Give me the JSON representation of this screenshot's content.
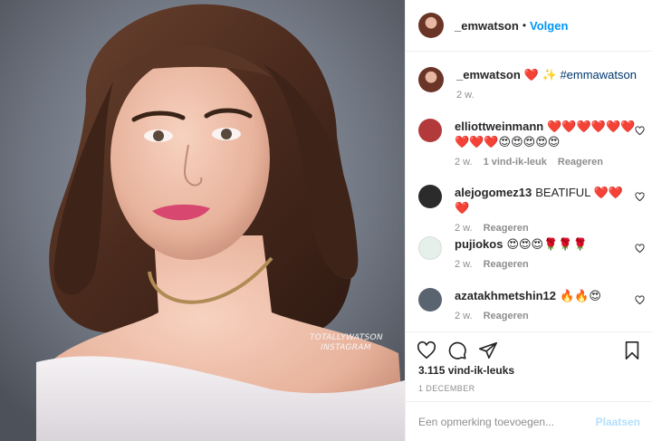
{
  "photo": {
    "watermark_line1": "TOTALLYWATSON",
    "watermark_line2": "INSTAGRAM"
  },
  "header": {
    "username": "_emwatson",
    "dot": "•",
    "follow_label": "Volgen"
  },
  "caption": {
    "username": "_emwatson",
    "text": "❤️ ✨",
    "hashtag": "#emmawatson",
    "time": "2 w."
  },
  "comments": [
    {
      "username": "elliottweinmann",
      "text": "❤️❤️❤️❤️❤️❤️❤️❤️❤️😍😍😍😍😍",
      "time": "2 w.",
      "likes": "1 vind-ik-leuk",
      "reply": "Reageren",
      "avatar_color": "#b23a3a"
    },
    {
      "username": "alejogomez13",
      "text": "BEATIFUL ❤️❤️❤️",
      "time": "2 w.",
      "likes": "",
      "reply": "Reageren",
      "avatar_color": "#2b2b2b"
    },
    {
      "username": "pujiokos",
      "text": "😍😍😍🌹🌹🌹",
      "time": "2 w.",
      "likes": "",
      "reply": "Reageren",
      "avatar_color": "#e6f0ea"
    },
    {
      "username": "azatakhmetshin12",
      "text": "🔥🔥😍",
      "time": "2 w.",
      "likes": "",
      "reply": "Reageren",
      "avatar_color": "#5a6470"
    }
  ],
  "icons": [
    "heart-icon",
    "comment-icon",
    "share-icon",
    "bookmark-icon"
  ],
  "likes_count": "3.115 vind-ik-leuks",
  "post_date": "1 DECEMBER",
  "composer": {
    "placeholder": "Een opmerking toevoegen...",
    "post_label": "Plaatsen"
  },
  "colors": {
    "accent": "#0095f6",
    "post_disabled": "#b2dffc",
    "muted": "#8e8e8e"
  }
}
